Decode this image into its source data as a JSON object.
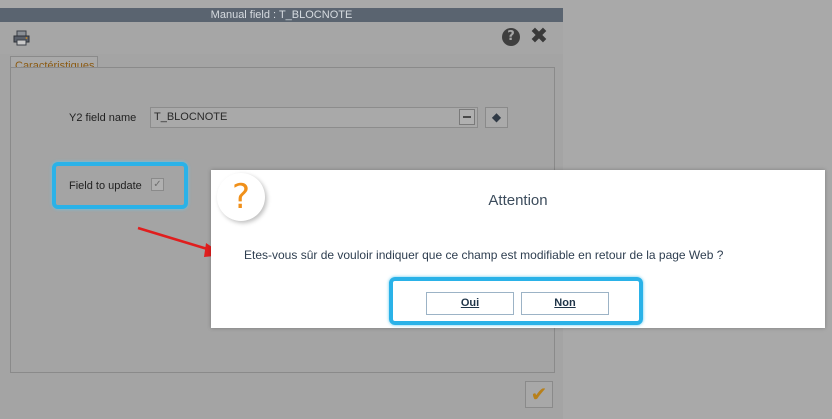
{
  "window": {
    "title": "Manual field : T_BLOCNOTE",
    "help_icon": "?",
    "close_icon": "✖"
  },
  "tabs": [
    {
      "label": "Caractéristiques"
    }
  ],
  "form": {
    "field_name_label": "Y2 field name",
    "field_name_value": "T_BLOCNOTE",
    "field_to_update_label": "Field to update",
    "field_to_update_checked": true
  },
  "footer": {
    "ok_icon": "✔"
  },
  "dialog": {
    "icon": "?",
    "title": "Attention",
    "message": "Etes-vous sûr de vouloir indiquer que ce champ est modifiable en retour de la page Web ?",
    "buttons": {
      "yes": "Oui",
      "no": "Non"
    }
  },
  "colors": {
    "highlight": "#2ab2e8",
    "arrow": "#e01e1e",
    "dialog_icon": "#f0901a"
  }
}
